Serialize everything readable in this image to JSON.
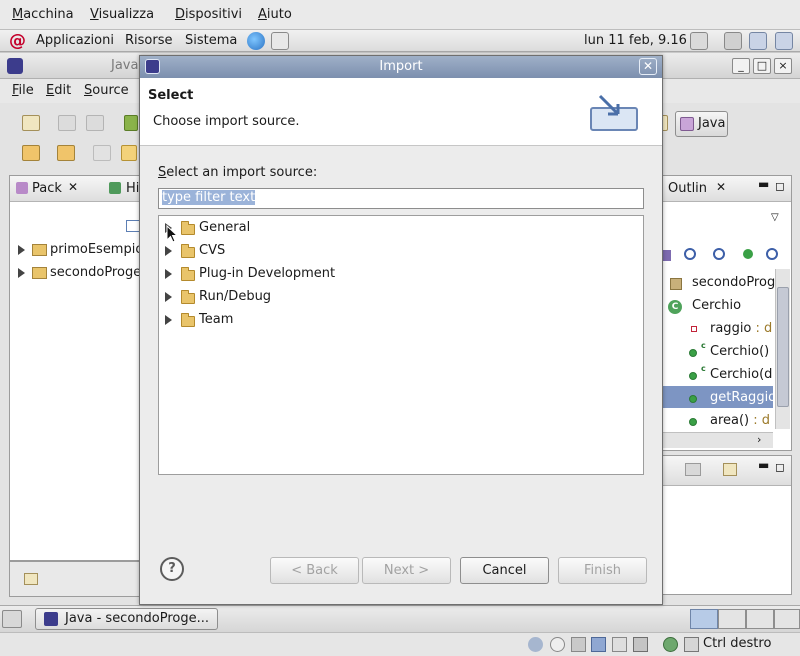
{
  "vbox_menu": {
    "items": [
      "Macchina",
      "Visualizza",
      "Dispositivi",
      "Aiuto"
    ]
  },
  "gnome_panel": {
    "menus": [
      "Applicazioni",
      "Risorse",
      "Sistema"
    ],
    "clock": "lun 11 feb,  9.16"
  },
  "eclipse": {
    "title": "Java",
    "menu": [
      "File",
      "Edit",
      "Source"
    ],
    "perspective": "Java",
    "package_explorer": {
      "tab_label": "Pack",
      "second_tab": "Hi",
      "items": [
        "primoEsempio",
        "secondoProge"
      ]
    },
    "outline": {
      "tab_label": "Outlin",
      "items": [
        {
          "text": "secondoProg",
          "icon": "package-declaration-icon"
        },
        {
          "text": "Cerchio",
          "icon": "class-icon"
        },
        {
          "text": "raggio",
          "type": " : d",
          "icon": "private-field-icon"
        },
        {
          "text": "Cerchio()",
          "icon": "public-constructor-icon"
        },
        {
          "text": "Cerchio(d",
          "icon": "public-constructor-icon"
        },
        {
          "text": "getRaggio",
          "icon": "public-method-icon"
        },
        {
          "text": "area()",
          "type": " : d",
          "icon": "public-method-icon"
        }
      ]
    }
  },
  "taskbar": {
    "window_button": "Java - secondoProge..."
  },
  "vbox_status": {
    "host_key": "Ctrl destro"
  },
  "dialog": {
    "title": "Import",
    "heading": "Select",
    "description": "Choose import source.",
    "source_label": "Select an import source:",
    "filter_placeholder": "type filter text",
    "tree": [
      "General",
      "CVS",
      "Plug-in Development",
      "Run/Debug",
      "Team"
    ],
    "buttons": {
      "back": "< Back",
      "next": "Next >",
      "cancel": "Cancel",
      "finish": "Finish"
    }
  },
  "colors": {
    "dialog_titlebar": "#8797b4",
    "selection": "#7d95c3",
    "folder": "#e9c46a"
  }
}
